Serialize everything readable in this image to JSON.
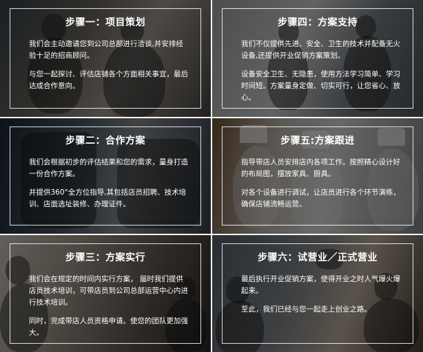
{
  "steps": [
    {
      "title": "步骤一：项目策划",
      "paragraphs": [
        "我们会主动邀请您到公司总部进行洽谈,并安排经验十足的招商顾问。",
        "与您一起探讨、评估店铺各个方面相关事宜，最后达成合作意向。"
      ]
    },
    {
      "title": "步骤四：方案支持",
      "paragraphs": [
        "我们不仅提供先进、安全、卫生的技术并配备无火设备,还提供开业促销方案策划。",
        "设备安全卫生、无隐患，使用方法学习简单、学习时间短。方案量身定做、切实可行，让您省心、放心。"
      ]
    },
    {
      "title": "步骤二：合作方案",
      "paragraphs": [
        "我们会根据初步的评估结果和您的需求，量身打造一份合作方案。",
        "并提供360°全方位指导,其包括店员招聘、技术培训、店面选址装修、办理证件。"
      ]
    },
    {
      "title": "步骤五:方案跟进",
      "paragraphs": [
        "指导带店人员安排店内各项工作。按照精心设计好的布局图，摆放家具、厨具。",
        "对各个设备进行调试，让店员进行各个环节演练，确保店铺流畅运营。"
      ]
    },
    {
      "title": "步骤三：方案实行",
      "paragraphs": [
        "我们会在规定的时间内实行方案， 届时我们提供店员技术培训，可带店员到公司总部运营中心内进行技术培训。",
        "同时，完成带店人员资格申请。使您的团队更加强大。"
      ]
    },
    {
      "title": "步骤六：试营业／正式营业",
      "paragraphs": [
        "最后执行开业促销方案，使得开业之时人气爆火爆起来。",
        "至此，我们已经与您一起走上创业之路。"
      ]
    }
  ]
}
